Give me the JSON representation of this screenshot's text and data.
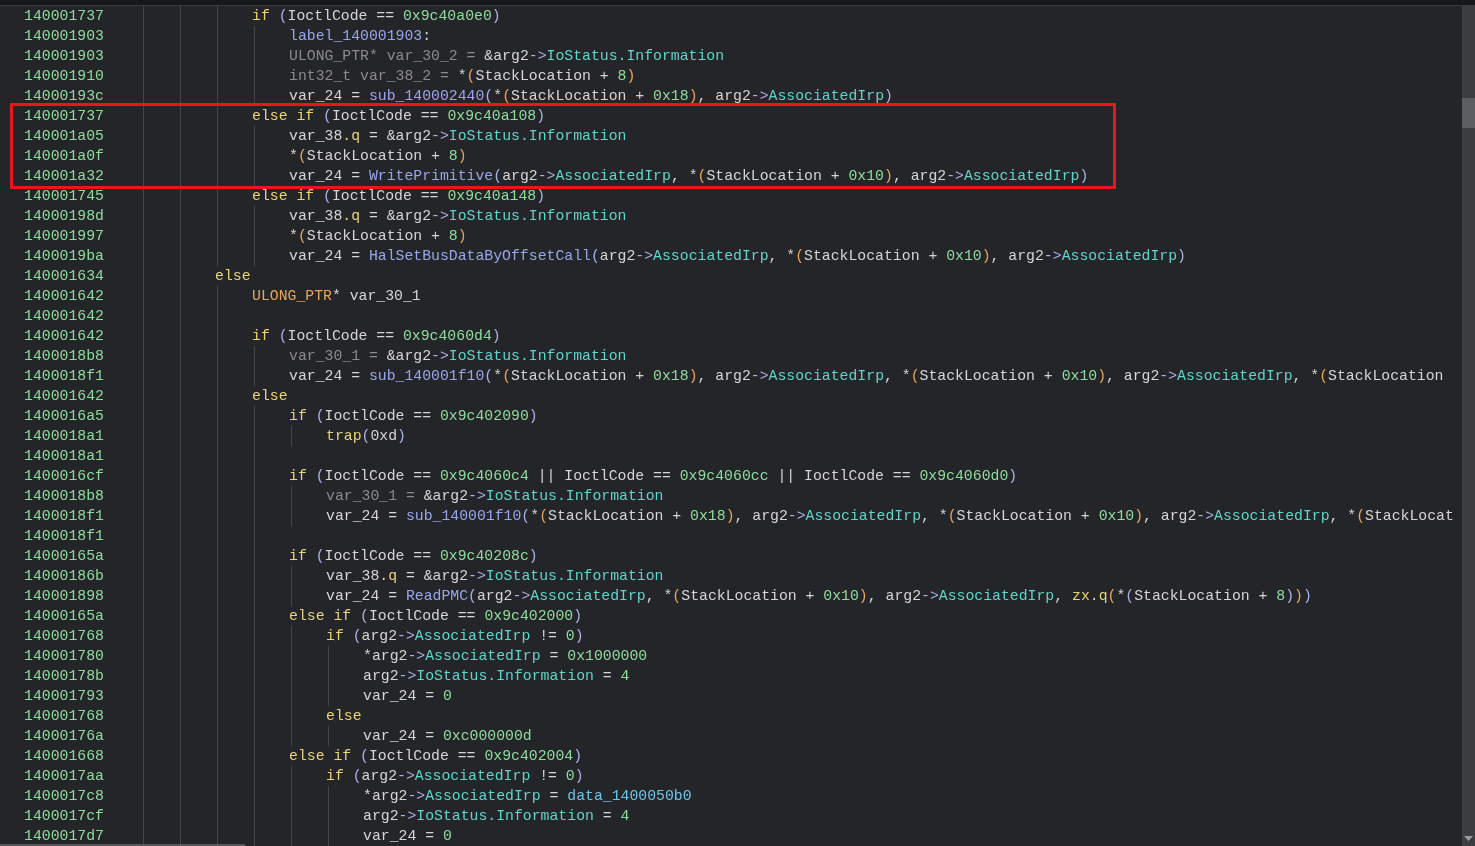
{
  "listing": [
    {
      "children": [
        {
          "address": "140001737",
          "highlighted": false,
          "tokens": [
            {
              "kind": "kw",
              "text": "if"
            },
            {
              "kind": "op",
              "text": " ("
            },
            {
              "kind": "plain",
              "text": "IoctlCode == "
            },
            {
              "kind": "num",
              "text": "0x9c40a0e0"
            },
            {
              "kind": "op",
              "text": ")"
            }
          ],
          "children": [
            {
              "address": "140001903",
              "tokens": [
                {
                  "kind": "label",
                  "text": "label_140001903"
                },
                {
                  "kind": "plain",
                  "text": ":"
                }
              ]
            },
            {
              "address": "140001903",
              "tokens": [
                {
                  "kind": "dim",
                  "text": "ULONG_PTR* var_30_2 = "
                },
                {
                  "kind": "plain",
                  "text": "&arg2"
                },
                {
                  "kind": "op",
                  "text": "->"
                },
                {
                  "kind": "field",
                  "text": "IoStatus.Information"
                }
              ]
            },
            {
              "address": "140001910",
              "tokens": [
                {
                  "kind": "dim",
                  "text": "int32_t var_38_2 = "
                },
                {
                  "kind": "plain",
                  "text": "*"
                },
                {
                  "kind": "paren",
                  "text": "("
                },
                {
                  "kind": "plain",
                  "text": "StackLocation + "
                },
                {
                  "kind": "num",
                  "text": "8"
                },
                {
                  "kind": "paren",
                  "text": ")"
                }
              ]
            },
            {
              "address": "14000193c",
              "tokens": [
                {
                  "kind": "plain",
                  "text": "var_24 = "
                },
                {
                  "kind": "fn",
                  "text": "sub_140002440"
                },
                {
                  "kind": "op",
                  "text": "("
                },
                {
                  "kind": "plain",
                  "text": "*"
                },
                {
                  "kind": "paren",
                  "text": "("
                },
                {
                  "kind": "plain",
                  "text": "StackLocation + "
                },
                {
                  "kind": "num",
                  "text": "0x18"
                },
                {
                  "kind": "paren",
                  "text": ")"
                },
                {
                  "kind": "plain",
                  "text": ", arg2"
                },
                {
                  "kind": "op",
                  "text": "->"
                },
                {
                  "kind": "field",
                  "text": "AssociatedIrp"
                },
                {
                  "kind": "op",
                  "text": ")"
                }
              ]
            }
          ]
        },
        {
          "address": "140001737",
          "highlighted": true,
          "tokens": [
            {
              "kind": "kw",
              "text": "else if"
            },
            {
              "kind": "op",
              "text": " ("
            },
            {
              "kind": "plain",
              "text": "IoctlCode == "
            },
            {
              "kind": "num",
              "text": "0x9c40a108"
            },
            {
              "kind": "op",
              "text": ")"
            }
          ],
          "children": [
            {
              "address": "140001a05",
              "tokens": [
                {
                  "kind": "plain",
                  "text": "var_38"
                },
                {
                  "kind": "kw",
                  "text": ".q"
                },
                {
                  "kind": "plain",
                  "text": " = &arg2"
                },
                {
                  "kind": "op",
                  "text": "->"
                },
                {
                  "kind": "field",
                  "text": "IoStatus.Information"
                }
              ]
            },
            {
              "address": "140001a0f",
              "tokens": [
                {
                  "kind": "plain",
                  "text": "*"
                },
                {
                  "kind": "paren",
                  "text": "("
                },
                {
                  "kind": "plain",
                  "text": "StackLocation + "
                },
                {
                  "kind": "num",
                  "text": "8"
                },
                {
                  "kind": "paren",
                  "text": ")"
                }
              ]
            },
            {
              "address": "140001a32",
              "tokens": [
                {
                  "kind": "plain",
                  "text": "var_24 = "
                },
                {
                  "kind": "fn",
                  "text": "WritePrimitive"
                },
                {
                  "kind": "op",
                  "text": "("
                },
                {
                  "kind": "plain",
                  "text": "arg2"
                },
                {
                  "kind": "op",
                  "text": "->"
                },
                {
                  "kind": "field",
                  "text": "AssociatedIrp"
                },
                {
                  "kind": "plain",
                  "text": ", *"
                },
                {
                  "kind": "paren",
                  "text": "("
                },
                {
                  "kind": "plain",
                  "text": "StackLocation + "
                },
                {
                  "kind": "num",
                  "text": "0x10"
                },
                {
                  "kind": "paren",
                  "text": ")"
                },
                {
                  "kind": "plain",
                  "text": ", arg2"
                },
                {
                  "kind": "op",
                  "text": "->"
                },
                {
                  "kind": "field",
                  "text": "AssociatedIrp"
                },
                {
                  "kind": "op",
                  "text": ")"
                }
              ]
            }
          ]
        },
        {
          "address": "140001745",
          "highlighted": false,
          "tokens": [
            {
              "kind": "kw",
              "text": "else if"
            },
            {
              "kind": "op",
              "text": " ("
            },
            {
              "kind": "plain",
              "text": "IoctlCode == "
            },
            {
              "kind": "num",
              "text": "0x9c40a148"
            },
            {
              "kind": "op",
              "text": ")"
            }
          ],
          "children": [
            {
              "address": "14000198d",
              "tokens": [
                {
                  "kind": "plain",
                  "text": "var_38"
                },
                {
                  "kind": "kw",
                  "text": ".q"
                },
                {
                  "kind": "plain",
                  "text": " = &arg2"
                },
                {
                  "kind": "op",
                  "text": "->"
                },
                {
                  "kind": "field",
                  "text": "IoStatus.Information"
                }
              ]
            },
            {
              "address": "140001997",
              "tokens": [
                {
                  "kind": "plain",
                  "text": "*"
                },
                {
                  "kind": "paren",
                  "text": "("
                },
                {
                  "kind": "plain",
                  "text": "StackLocation + "
                },
                {
                  "kind": "num",
                  "text": "8"
                },
                {
                  "kind": "paren",
                  "text": ")"
                }
              ]
            },
            {
              "address": "1400019ba",
              "tokens": [
                {
                  "kind": "plain",
                  "text": "var_24 = "
                },
                {
                  "kind": "fn",
                  "text": "HalSetBusDataByOffsetCall"
                },
                {
                  "kind": "op",
                  "text": "("
                },
                {
                  "kind": "plain",
                  "text": "arg2"
                },
                {
                  "kind": "op",
                  "text": "->"
                },
                {
                  "kind": "field",
                  "text": "AssociatedIrp"
                },
                {
                  "kind": "plain",
                  "text": ", *"
                },
                {
                  "kind": "paren",
                  "text": "("
                },
                {
                  "kind": "plain",
                  "text": "StackLocation + "
                },
                {
                  "kind": "num",
                  "text": "0x10"
                },
                {
                  "kind": "paren",
                  "text": ")"
                },
                {
                  "kind": "plain",
                  "text": ", arg2"
                },
                {
                  "kind": "op",
                  "text": "->"
                },
                {
                  "kind": "field",
                  "text": "AssociatedIrp"
                },
                {
                  "kind": "op",
                  "text": ")"
                }
              ]
            }
          ]
        }
      ]
    },
    {
      "address": "140001634",
      "tokens": [
        {
          "kind": "kw",
          "text": "else"
        }
      ],
      "children": [
        {
          "address": "140001642",
          "tokens": [
            {
              "kind": "type",
              "text": "ULONG_PTR"
            },
            {
              "kind": "plain",
              "text": "* var_30_1"
            }
          ]
        },
        {
          "address": "140001642"
        },
        {
          "address": "140001642",
          "tokens": [
            {
              "kind": "kw",
              "text": "if"
            },
            {
              "kind": "op",
              "text": " ("
            },
            {
              "kind": "plain",
              "text": "IoctlCode == "
            },
            {
              "kind": "num",
              "text": "0x9c4060d4"
            },
            {
              "kind": "op",
              "text": ")"
            }
          ],
          "children": [
            {
              "address": "1400018b8",
              "tokens": [
                {
                  "kind": "dim",
                  "text": "var_30_1 = "
                },
                {
                  "kind": "plain",
                  "text": "&arg2"
                },
                {
                  "kind": "op",
                  "text": "->"
                },
                {
                  "kind": "field",
                  "text": "IoStatus.Information"
                }
              ]
            },
            {
              "address": "1400018f1",
              "tokens": [
                {
                  "kind": "plain",
                  "text": "var_24 = "
                },
                {
                  "kind": "fn",
                  "text": "sub_140001f10"
                },
                {
                  "kind": "op",
                  "text": "("
                },
                {
                  "kind": "plain",
                  "text": "*"
                },
                {
                  "kind": "paren",
                  "text": "("
                },
                {
                  "kind": "plain",
                  "text": "StackLocation + "
                },
                {
                  "kind": "num",
                  "text": "0x18"
                },
                {
                  "kind": "paren",
                  "text": ")"
                },
                {
                  "kind": "plain",
                  "text": ", arg2"
                },
                {
                  "kind": "op",
                  "text": "->"
                },
                {
                  "kind": "field",
                  "text": "AssociatedIrp"
                },
                {
                  "kind": "plain",
                  "text": ", *"
                },
                {
                  "kind": "paren",
                  "text": "("
                },
                {
                  "kind": "plain",
                  "text": "StackLocation + "
                },
                {
                  "kind": "num",
                  "text": "0x10"
                },
                {
                  "kind": "paren",
                  "text": ")"
                },
                {
                  "kind": "plain",
                  "text": ", arg2"
                },
                {
                  "kind": "op",
                  "text": "->"
                },
                {
                  "kind": "field",
                  "text": "AssociatedIrp"
                },
                {
                  "kind": "plain",
                  "text": ", *"
                },
                {
                  "kind": "paren",
                  "text": "("
                },
                {
                  "kind": "plain",
                  "text": "StackLocation"
                }
              ]
            }
          ]
        },
        {
          "address": "140001642",
          "tokens": [
            {
              "kind": "kw",
              "text": "else"
            }
          ],
          "children": [
            {
              "address": "1400016a5",
              "tokens": [
                {
                  "kind": "kw",
                  "text": "if"
                },
                {
                  "kind": "op",
                  "text": " ("
                },
                {
                  "kind": "plain",
                  "text": "IoctlCode == "
                },
                {
                  "kind": "num",
                  "text": "0x9c402090"
                },
                {
                  "kind": "op",
                  "text": ")"
                }
              ],
              "children": [
                {
                  "address": "1400018a1",
                  "tokens": [
                    {
                      "kind": "kw",
                      "text": "trap"
                    },
                    {
                      "kind": "op",
                      "text": "("
                    },
                    {
                      "kind": "plain",
                      "text": "0xd"
                    },
                    {
                      "kind": "op",
                      "text": ")"
                    }
                  ]
                }
              ]
            },
            {
              "address": "1400018a1"
            },
            {
              "address": "1400016cf",
              "tokens": [
                {
                  "kind": "kw",
                  "text": "if"
                },
                {
                  "kind": "op",
                  "text": " ("
                },
                {
                  "kind": "plain",
                  "text": "IoctlCode == "
                },
                {
                  "kind": "num",
                  "text": "0x9c4060c4"
                },
                {
                  "kind": "plain",
                  "text": " || IoctlCode == "
                },
                {
                  "kind": "num",
                  "text": "0x9c4060cc"
                },
                {
                  "kind": "plain",
                  "text": " || IoctlCode == "
                },
                {
                  "kind": "num",
                  "text": "0x9c4060d0"
                },
                {
                  "kind": "op",
                  "text": ")"
                }
              ],
              "children": [
                {
                  "address": "1400018b8",
                  "tokens": [
                    {
                      "kind": "dim",
                      "text": "var_30_1 = "
                    },
                    {
                      "kind": "plain",
                      "text": "&arg2"
                    },
                    {
                      "kind": "op",
                      "text": "->"
                    },
                    {
                      "kind": "field",
                      "text": "IoStatus.Information"
                    }
                  ]
                },
                {
                  "address": "1400018f1",
                  "tokens": [
                    {
                      "kind": "plain",
                      "text": "var_24 = "
                    },
                    {
                      "kind": "fn",
                      "text": "sub_140001f10"
                    },
                    {
                      "kind": "op",
                      "text": "("
                    },
                    {
                      "kind": "plain",
                      "text": "*"
                    },
                    {
                      "kind": "paren",
                      "text": "("
                    },
                    {
                      "kind": "plain",
                      "text": "StackLocation + "
                    },
                    {
                      "kind": "num",
                      "text": "0x18"
                    },
                    {
                      "kind": "paren",
                      "text": ")"
                    },
                    {
                      "kind": "plain",
                      "text": ", arg2"
                    },
                    {
                      "kind": "op",
                      "text": "->"
                    },
                    {
                      "kind": "field",
                      "text": "AssociatedIrp"
                    },
                    {
                      "kind": "plain",
                      "text": ", *"
                    },
                    {
                      "kind": "paren",
                      "text": "("
                    },
                    {
                      "kind": "plain",
                      "text": "StackLocation + "
                    },
                    {
                      "kind": "num",
                      "text": "0x10"
                    },
                    {
                      "kind": "paren",
                      "text": ")"
                    },
                    {
                      "kind": "plain",
                      "text": ", arg2"
                    },
                    {
                      "kind": "op",
                      "text": "->"
                    },
                    {
                      "kind": "field",
                      "text": "AssociatedIrp"
                    },
                    {
                      "kind": "plain",
                      "text": ", *"
                    },
                    {
                      "kind": "paren",
                      "text": "("
                    },
                    {
                      "kind": "plain",
                      "text": "StackLocat"
                    }
                  ]
                }
              ]
            },
            {
              "address": "1400018f1"
            },
            {
              "address": "14000165a",
              "tokens": [
                {
                  "kind": "kw",
                  "text": "if"
                },
                {
                  "kind": "op",
                  "text": " ("
                },
                {
                  "kind": "plain",
                  "text": "IoctlCode == "
                },
                {
                  "kind": "num",
                  "text": "0x9c40208c"
                },
                {
                  "kind": "op",
                  "text": ")"
                }
              ],
              "children": [
                {
                  "address": "14000186b",
                  "tokens": [
                    {
                      "kind": "plain",
                      "text": "var_38"
                    },
                    {
                      "kind": "kw",
                      "text": ".q"
                    },
                    {
                      "kind": "plain",
                      "text": " = &arg2"
                    },
                    {
                      "kind": "op",
                      "text": "->"
                    },
                    {
                      "kind": "field",
                      "text": "IoStatus.Information"
                    }
                  ]
                },
                {
                  "address": "140001898",
                  "tokens": [
                    {
                      "kind": "plain",
                      "text": "var_24 = "
                    },
                    {
                      "kind": "fn",
                      "text": "ReadPMC"
                    },
                    {
                      "kind": "op",
                      "text": "("
                    },
                    {
                      "kind": "plain",
                      "text": "arg2"
                    },
                    {
                      "kind": "op",
                      "text": "->"
                    },
                    {
                      "kind": "field",
                      "text": "AssociatedIrp"
                    },
                    {
                      "kind": "plain",
                      "text": ", *"
                    },
                    {
                      "kind": "paren",
                      "text": "("
                    },
                    {
                      "kind": "plain",
                      "text": "StackLocation + "
                    },
                    {
                      "kind": "num",
                      "text": "0x10"
                    },
                    {
                      "kind": "paren",
                      "text": ")"
                    },
                    {
                      "kind": "plain",
                      "text": ", arg2"
                    },
                    {
                      "kind": "op",
                      "text": "->"
                    },
                    {
                      "kind": "field",
                      "text": "AssociatedIrp"
                    },
                    {
                      "kind": "plain",
                      "text": ", "
                    },
                    {
                      "kind": "kw",
                      "text": "zx.q"
                    },
                    {
                      "kind": "paren",
                      "text": "("
                    },
                    {
                      "kind": "plain",
                      "text": "*"
                    },
                    {
                      "kind": "op",
                      "text": "("
                    },
                    {
                      "kind": "plain",
                      "text": "StackLocation + "
                    },
                    {
                      "kind": "num",
                      "text": "8"
                    },
                    {
                      "kind": "op",
                      "text": ")"
                    },
                    {
                      "kind": "paren",
                      "text": ")"
                    },
                    {
                      "kind": "op",
                      "text": ")"
                    }
                  ]
                }
              ]
            },
            {
              "address": "14000165a",
              "tokens": [
                {
                  "kind": "kw",
                  "text": "else if"
                },
                {
                  "kind": "op",
                  "text": " ("
                },
                {
                  "kind": "plain",
                  "text": "IoctlCode == "
                },
                {
                  "kind": "num",
                  "text": "0x9c402000"
                },
                {
                  "kind": "op",
                  "text": ")"
                }
              ],
              "children": [
                {
                  "address": "140001768",
                  "tokens": [
                    {
                      "kind": "kw",
                      "text": "if"
                    },
                    {
                      "kind": "op",
                      "text": " ("
                    },
                    {
                      "kind": "plain",
                      "text": "arg2"
                    },
                    {
                      "kind": "op",
                      "text": "->"
                    },
                    {
                      "kind": "field",
                      "text": "AssociatedIrp"
                    },
                    {
                      "kind": "plain",
                      "text": " != "
                    },
                    {
                      "kind": "num",
                      "text": "0"
                    },
                    {
                      "kind": "op",
                      "text": ")"
                    }
                  ],
                  "children": [
                    {
                      "address": "140001780",
                      "tokens": [
                        {
                          "kind": "plain",
                          "text": "*arg2"
                        },
                        {
                          "kind": "op",
                          "text": "->"
                        },
                        {
                          "kind": "field",
                          "text": "AssociatedIrp"
                        },
                        {
                          "kind": "plain",
                          "text": " = "
                        },
                        {
                          "kind": "num",
                          "text": "0x1000000"
                        }
                      ]
                    },
                    {
                      "address": "14000178b",
                      "tokens": [
                        {
                          "kind": "plain",
                          "text": "arg2"
                        },
                        {
                          "kind": "op",
                          "text": "->"
                        },
                        {
                          "kind": "field",
                          "text": "IoStatus.Information"
                        },
                        {
                          "kind": "plain",
                          "text": " = "
                        },
                        {
                          "kind": "num",
                          "text": "4"
                        }
                      ]
                    },
                    {
                      "address": "140001793",
                      "tokens": [
                        {
                          "kind": "plain",
                          "text": "var_24 = "
                        },
                        {
                          "kind": "num",
                          "text": "0"
                        }
                      ]
                    }
                  ]
                },
                {
                  "address": "140001768",
                  "tokens": [
                    {
                      "kind": "kw",
                      "text": "else"
                    }
                  ],
                  "children": [
                    {
                      "address": "14000176a",
                      "tokens": [
                        {
                          "kind": "plain",
                          "text": "var_24 = "
                        },
                        {
                          "kind": "num",
                          "text": "0xc000000d"
                        }
                      ]
                    }
                  ]
                }
              ]
            },
            {
              "address": "140001668",
              "tokens": [
                {
                  "kind": "kw",
                  "text": "else if"
                },
                {
                  "kind": "op",
                  "text": " ("
                },
                {
                  "kind": "plain",
                  "text": "IoctlCode == "
                },
                {
                  "kind": "num",
                  "text": "0x9c402004"
                },
                {
                  "kind": "op",
                  "text": ")"
                }
              ],
              "children": [
                {
                  "address": "1400017aa",
                  "tokens": [
                    {
                      "kind": "kw",
                      "text": "if"
                    },
                    {
                      "kind": "op",
                      "text": " ("
                    },
                    {
                      "kind": "plain",
                      "text": "arg2"
                    },
                    {
                      "kind": "op",
                      "text": "->"
                    },
                    {
                      "kind": "field",
                      "text": "AssociatedIrp"
                    },
                    {
                      "kind": "plain",
                      "text": " != "
                    },
                    {
                      "kind": "num",
                      "text": "0"
                    },
                    {
                      "kind": "op",
                      "text": ")"
                    }
                  ],
                  "children": [
                    {
                      "address": "1400017c8",
                      "tokens": [
                        {
                          "kind": "plain",
                          "text": "*arg2"
                        },
                        {
                          "kind": "op",
                          "text": "->"
                        },
                        {
                          "kind": "field",
                          "text": "AssociatedIrp"
                        },
                        {
                          "kind": "plain",
                          "text": " = "
                        },
                        {
                          "kind": "data",
                          "text": "data_1400050b0"
                        }
                      ]
                    },
                    {
                      "address": "1400017cf",
                      "tokens": [
                        {
                          "kind": "plain",
                          "text": "arg2"
                        },
                        {
                          "kind": "op",
                          "text": "->"
                        },
                        {
                          "kind": "field",
                          "text": "IoStatus.Information"
                        },
                        {
                          "kind": "plain",
                          "text": " = "
                        },
                        {
                          "kind": "num",
                          "text": "4"
                        }
                      ]
                    },
                    {
                      "address": "1400017d7",
                      "tokens": [
                        {
                          "kind": "plain",
                          "text": "var_24 = "
                        },
                        {
                          "kind": "num",
                          "text": "0"
                        }
                      ]
                    }
                  ]
                }
              ]
            }
          ]
        }
      ]
    }
  ]
}
